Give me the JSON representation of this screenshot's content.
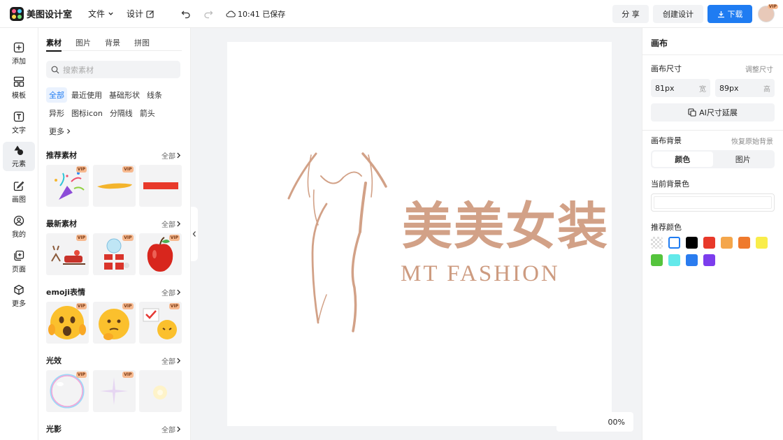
{
  "app": {
    "name": "美图设计室"
  },
  "menu": {
    "file": "文件",
    "design": "设计",
    "saved_text": "10:41 已保存"
  },
  "actions": {
    "share": "分 享",
    "create": "创建设计",
    "download": "下载",
    "avatar_badge": "VIP"
  },
  "rail": [
    {
      "id": "add",
      "label": "添加"
    },
    {
      "id": "template",
      "label": "模板"
    },
    {
      "id": "text",
      "label": "文字"
    },
    {
      "id": "element",
      "label": "元素"
    },
    {
      "id": "draw",
      "label": "画图"
    },
    {
      "id": "mine",
      "label": "我的"
    },
    {
      "id": "page",
      "label": "页面"
    },
    {
      "id": "more",
      "label": "更多"
    }
  ],
  "panel": {
    "tabs": [
      "素材",
      "图片",
      "背景",
      "拼图"
    ],
    "search_placeholder": "搜索素材",
    "chips": [
      "全部",
      "最近使用",
      "基础形状",
      "线条",
      "异形",
      "图标icon",
      "分隔线",
      "箭头",
      "更多"
    ],
    "all_label": "全部",
    "vip_label": "VIP",
    "sections": [
      "推荐素材",
      "最新素材",
      "emoji表情",
      "光效",
      "光影"
    ]
  },
  "canvas": {
    "brand_cn": "美美女装",
    "brand_en": "MT FASHION",
    "zoom": "00%"
  },
  "props": {
    "title": "画布",
    "size_label": "画布尺寸",
    "size_link": "调整尺寸",
    "width_value": "81px",
    "width_unit": "宽",
    "height_value": "89px",
    "height_unit": "高",
    "ai_button": "AI尺寸延展",
    "bg_label": "画布背景",
    "bg_link": "恢复原始背景",
    "seg_color": "颜色",
    "seg_image": "图片",
    "current_bg_label": "当前背景色",
    "recommend_label": "推荐颜色",
    "swatches": [
      "transparent",
      "#ffffff",
      "#000000",
      "#e8392a",
      "#f4a64b",
      "#ef7a2d",
      "#f9ed4a",
      "#55c43d",
      "#63e9ea",
      "#2a7cef",
      "#7c3ded"
    ]
  },
  "colors": {
    "accent": "#1f7cf2",
    "brand": "#d2a187"
  }
}
